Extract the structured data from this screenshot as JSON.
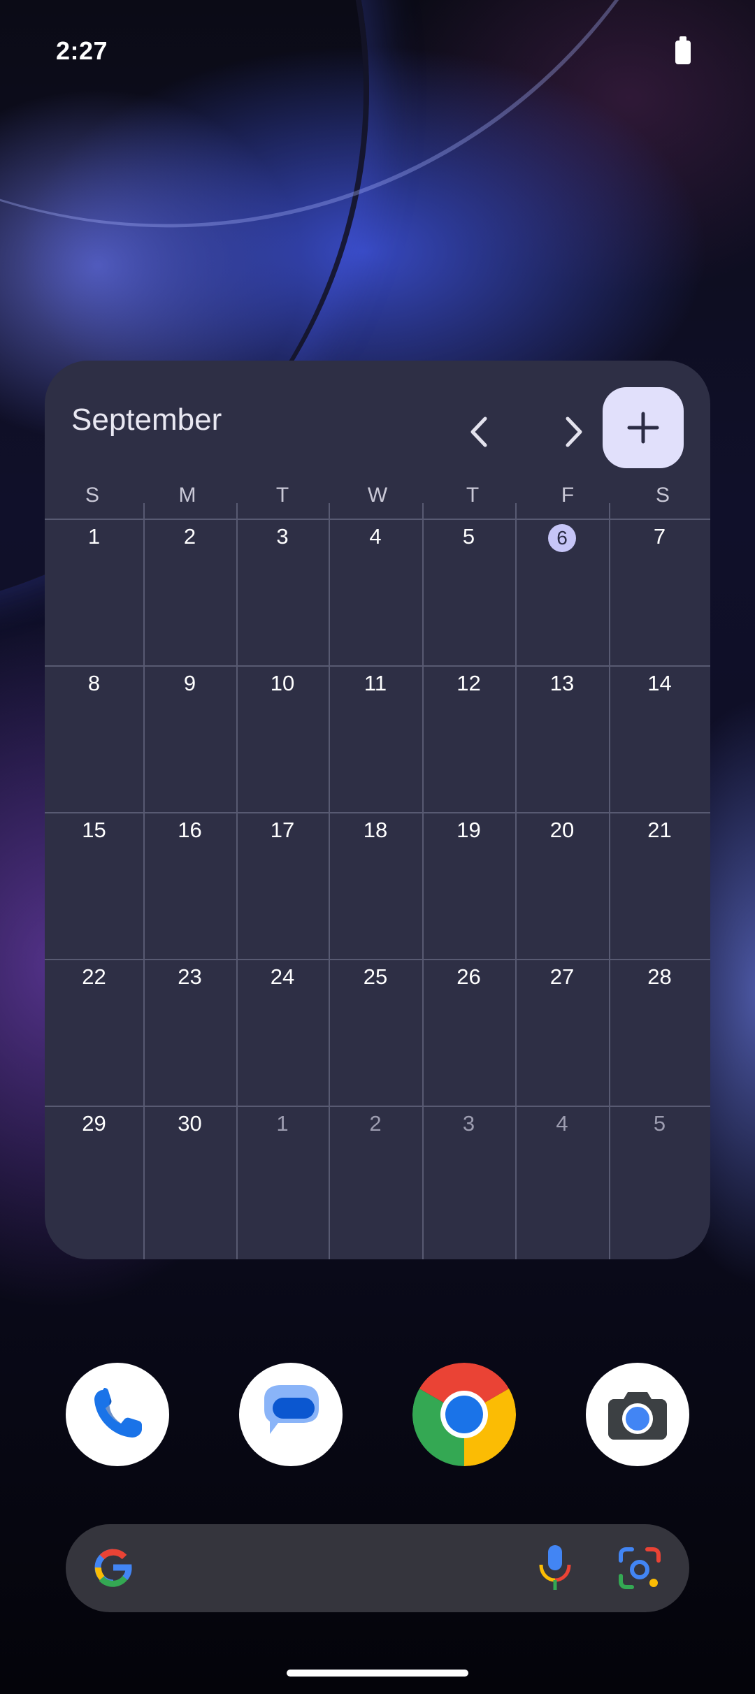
{
  "status_bar": {
    "time": "2:27",
    "battery_icon": "battery-full-icon"
  },
  "calendar_widget": {
    "month": "September",
    "prev_icon": "chevron-left-icon",
    "next_icon": "chevron-right-icon",
    "add_icon": "plus-icon",
    "weekdays": [
      "S",
      "M",
      "T",
      "W",
      "T",
      "F",
      "S"
    ],
    "weeks": [
      [
        "1",
        "2",
        "3",
        "4",
        "5",
        "6",
        "7"
      ],
      [
        "8",
        "9",
        "10",
        "11",
        "12",
        "13",
        "14"
      ],
      [
        "15",
        "16",
        "17",
        "18",
        "19",
        "20",
        "21"
      ],
      [
        "22",
        "23",
        "24",
        "25",
        "26",
        "27",
        "28"
      ],
      [
        "29",
        "30",
        "1",
        "2",
        "3",
        "4",
        "5"
      ]
    ],
    "today": "6",
    "colors": {
      "background": "#2e2f45",
      "today_highlight": "#c6c5f7",
      "add_button": "#e1e0fb"
    }
  },
  "dock": {
    "apps": [
      {
        "name": "Phone",
        "icon": "phone-icon"
      },
      {
        "name": "Messages",
        "icon": "messages-icon"
      },
      {
        "name": "Chrome",
        "icon": "chrome-icon"
      },
      {
        "name": "Camera",
        "icon": "camera-icon"
      }
    ]
  },
  "search_bar": {
    "google_icon": "google-g-icon",
    "mic_icon": "mic-icon",
    "lens_icon": "lens-icon"
  }
}
